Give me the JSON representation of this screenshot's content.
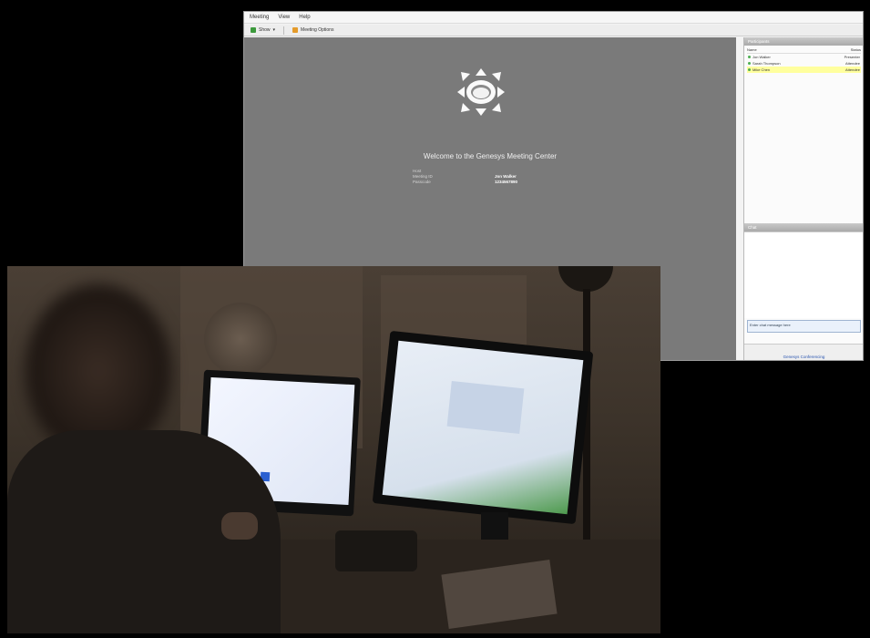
{
  "window": {
    "menu": [
      "Meeting",
      "View",
      "Help"
    ],
    "toolbar": {
      "share_label": "Show",
      "invite_label": "Meeting Options"
    },
    "stage": {
      "title": "Welcome to the Genesys Meeting Center",
      "info_rows": [
        {
          "label": "Host",
          "value": ""
        },
        {
          "label": "Meeting ID",
          "value": "Jon Walker"
        },
        {
          "label": "Passcode",
          "value": "1234567890"
        }
      ]
    },
    "sidebar": {
      "participants_header": "Participants",
      "columns": [
        "Name",
        "Status"
      ],
      "participants": [
        {
          "name": "Jon Walker",
          "status": "Presenter"
        },
        {
          "name": "Sarah Thompson",
          "status": "Attendee"
        },
        {
          "name": "Mike Chen",
          "status": "Attendee"
        }
      ],
      "chat_header": "Chat",
      "chat_placeholder": "Enter chat message here",
      "footer_link": "Genesys Conferencing"
    }
  },
  "colors": {
    "stage_bg": "#7a7a7a",
    "highlight_row": "#ffff9e",
    "toolbar_icon_green": "#3c9a3c",
    "toolbar_icon_orange": "#e49b2b"
  }
}
